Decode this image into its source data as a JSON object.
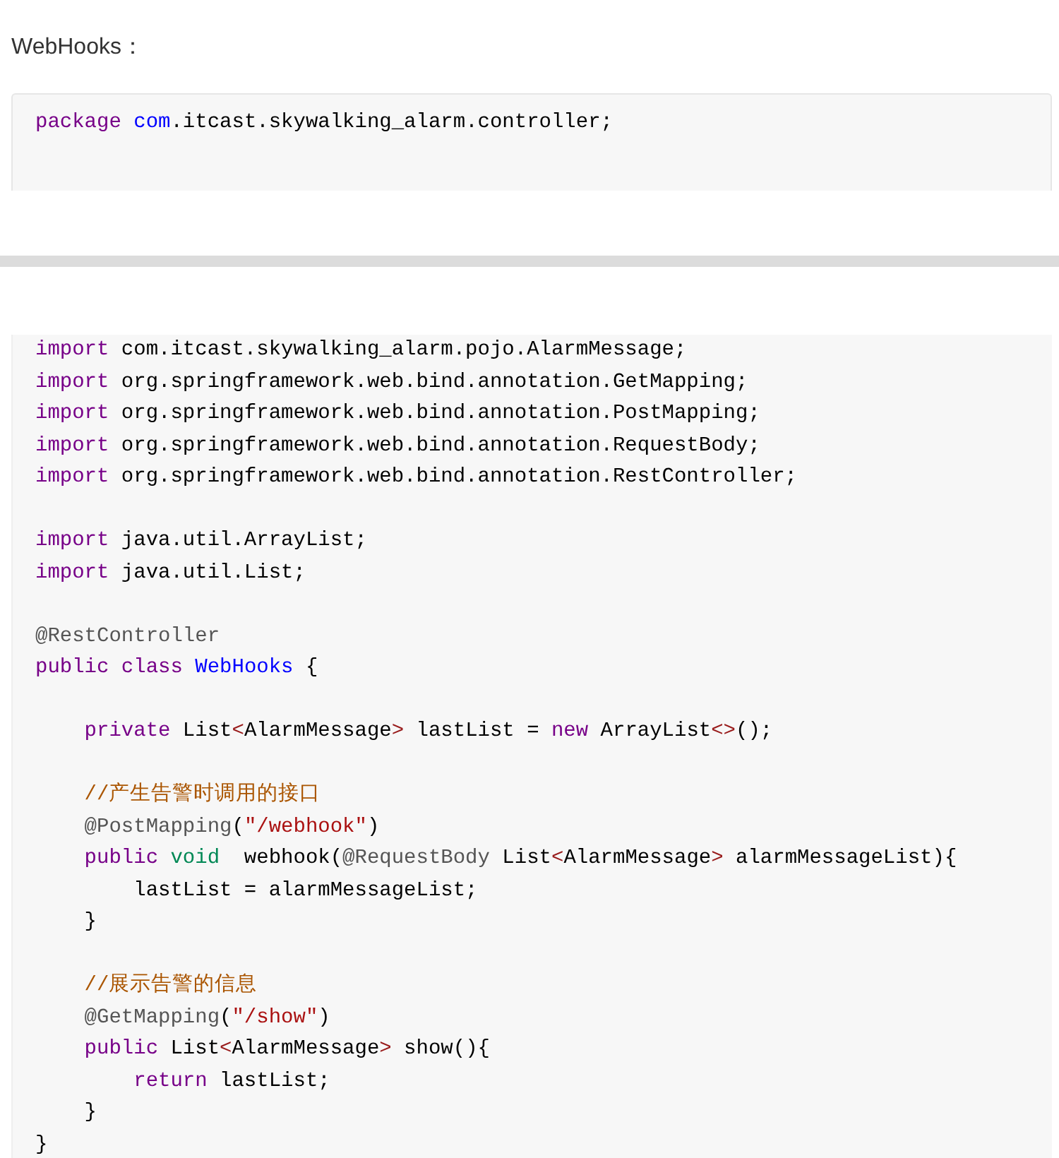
{
  "heading": "WebHooks：",
  "package_block": {
    "lines": [
      {
        "tokens": [
          {
            "text": "package",
            "kind": "keyword"
          },
          {
            "text": " com",
            "kind": "def"
          },
          {
            "text": ".itcast.skywalking_alarm.controller;",
            "kind": "plain"
          }
        ]
      }
    ]
  },
  "code_block": {
    "lines": [
      {
        "tokens": [
          {
            "text": "import",
            "kind": "keyword"
          },
          {
            "text": " com.itcast.skywalking_alarm.pojo.AlarmMessage;",
            "kind": "plain"
          }
        ]
      },
      {
        "tokens": [
          {
            "text": "import",
            "kind": "keyword"
          },
          {
            "text": " org.springframework.web.bind.annotation.GetMapping;",
            "kind": "plain"
          }
        ]
      },
      {
        "tokens": [
          {
            "text": "import",
            "kind": "keyword"
          },
          {
            "text": " org.springframework.web.bind.annotation.PostMapping;",
            "kind": "plain"
          }
        ]
      },
      {
        "tokens": [
          {
            "text": "import",
            "kind": "keyword"
          },
          {
            "text": " org.springframework.web.bind.annotation.RequestBody;",
            "kind": "plain"
          }
        ]
      },
      {
        "tokens": [
          {
            "text": "import",
            "kind": "keyword"
          },
          {
            "text": " org.springframework.web.bind.annotation.RestController;",
            "kind": "plain"
          }
        ]
      },
      {
        "kind": "blank"
      },
      {
        "tokens": [
          {
            "text": "import",
            "kind": "keyword"
          },
          {
            "text": " java.util.ArrayList;",
            "kind": "plain"
          }
        ]
      },
      {
        "tokens": [
          {
            "text": "import",
            "kind": "keyword"
          },
          {
            "text": " java.util.List;",
            "kind": "plain"
          }
        ]
      },
      {
        "kind": "blank"
      },
      {
        "tokens": [
          {
            "text": "@RestController",
            "kind": "annotation"
          }
        ]
      },
      {
        "tokens": [
          {
            "text": "public",
            "kind": "keyword"
          },
          {
            "text": " class",
            "kind": "keyword"
          },
          {
            "text": " WebHooks",
            "kind": "def"
          },
          {
            "text": " {",
            "kind": "plain"
          }
        ]
      },
      {
        "kind": "blank"
      },
      {
        "tokens": [
          {
            "text": "    private",
            "kind": "keyword"
          },
          {
            "text": " List",
            "kind": "plain"
          },
          {
            "text": "<",
            "kind": "bracket"
          },
          {
            "text": "AlarmMessage",
            "kind": "plain"
          },
          {
            "text": ">",
            "kind": "bracket"
          },
          {
            "text": " lastList = ",
            "kind": "plain"
          },
          {
            "text": "new",
            "kind": "keyword"
          },
          {
            "text": " ArrayList",
            "kind": "plain"
          },
          {
            "text": "<>",
            "kind": "bracket"
          },
          {
            "text": "();",
            "kind": "plain"
          }
        ]
      },
      {
        "kind": "blank"
      },
      {
        "tokens": [
          {
            "text": "    //产生告警时调用的接口",
            "kind": "comment"
          }
        ]
      },
      {
        "tokens": [
          {
            "text": "    @PostMapping",
            "kind": "annotation"
          },
          {
            "text": "(",
            "kind": "plain"
          },
          {
            "text": "\"/webhook\"",
            "kind": "string"
          },
          {
            "text": ")",
            "kind": "plain"
          }
        ]
      },
      {
        "tokens": [
          {
            "text": "    public",
            "kind": "keyword"
          },
          {
            "text": " void",
            "kind": "type"
          },
          {
            "text": "  webhook(",
            "kind": "plain"
          },
          {
            "text": "@RequestBody",
            "kind": "annotation"
          },
          {
            "text": " List",
            "kind": "plain"
          },
          {
            "text": "<",
            "kind": "bracket"
          },
          {
            "text": "AlarmMessage",
            "kind": "plain"
          },
          {
            "text": ">",
            "kind": "bracket"
          },
          {
            "text": " alarmMessageList){",
            "kind": "plain"
          }
        ]
      },
      {
        "tokens": [
          {
            "text": "        lastList = alarmMessageList;",
            "kind": "plain"
          }
        ]
      },
      {
        "tokens": [
          {
            "text": "    }",
            "kind": "plain"
          }
        ]
      },
      {
        "kind": "blank"
      },
      {
        "tokens": [
          {
            "text": "    //展示告警的信息",
            "kind": "comment"
          }
        ]
      },
      {
        "tokens": [
          {
            "text": "    @GetMapping",
            "kind": "annotation"
          },
          {
            "text": "(",
            "kind": "plain"
          },
          {
            "text": "\"/show\"",
            "kind": "string"
          },
          {
            "text": ")",
            "kind": "plain"
          }
        ]
      },
      {
        "tokens": [
          {
            "text": "    public",
            "kind": "keyword"
          },
          {
            "text": " List",
            "kind": "plain"
          },
          {
            "text": "<",
            "kind": "bracket"
          },
          {
            "text": "AlarmMessage",
            "kind": "plain"
          },
          {
            "text": ">",
            "kind": "bracket"
          },
          {
            "text": " show(){",
            "kind": "plain"
          }
        ]
      },
      {
        "tokens": [
          {
            "text": "        return",
            "kind": "keyword"
          },
          {
            "text": " lastList;",
            "kind": "plain"
          }
        ]
      },
      {
        "tokens": [
          {
            "text": "    }",
            "kind": "plain"
          }
        ]
      },
      {
        "tokens": [
          {
            "text": "}",
            "kind": "plain"
          }
        ]
      }
    ]
  }
}
